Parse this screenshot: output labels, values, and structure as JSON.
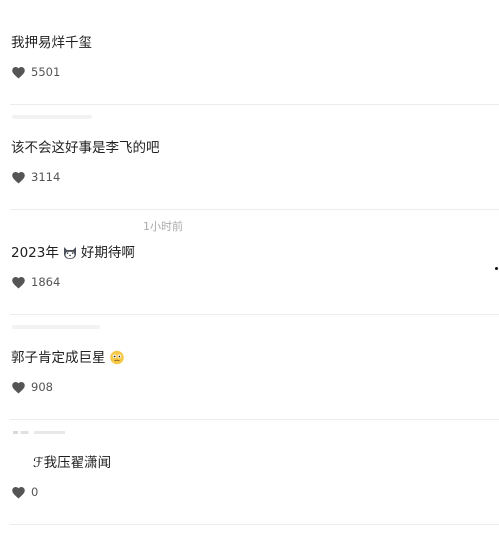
{
  "comments": [
    {
      "text": "我押易烊千玺",
      "likes": "5501",
      "emoji": ""
    },
    {
      "text": "该不会这好事是李飞的吧",
      "likes": "3114",
      "emoji": ""
    },
    {
      "text_before": "2023年",
      "text_after": "好期待啊",
      "likes": "1864",
      "emoji": "cat-face-emoji"
    },
    {
      "text": "郭子肯定成巨星",
      "likes": "908",
      "emoji": "thinking-face-emoji"
    },
    {
      "text": "ℱ我压翟潇闻",
      "likes": "0",
      "emoji": ""
    }
  ],
  "timestamp": "1小时前",
  "colors": {
    "heart": "#555555",
    "divider": "#ececec",
    "text": "#1f1f1f",
    "meta": "#aaaaaa"
  },
  "icons": {
    "like": "heart-icon"
  }
}
